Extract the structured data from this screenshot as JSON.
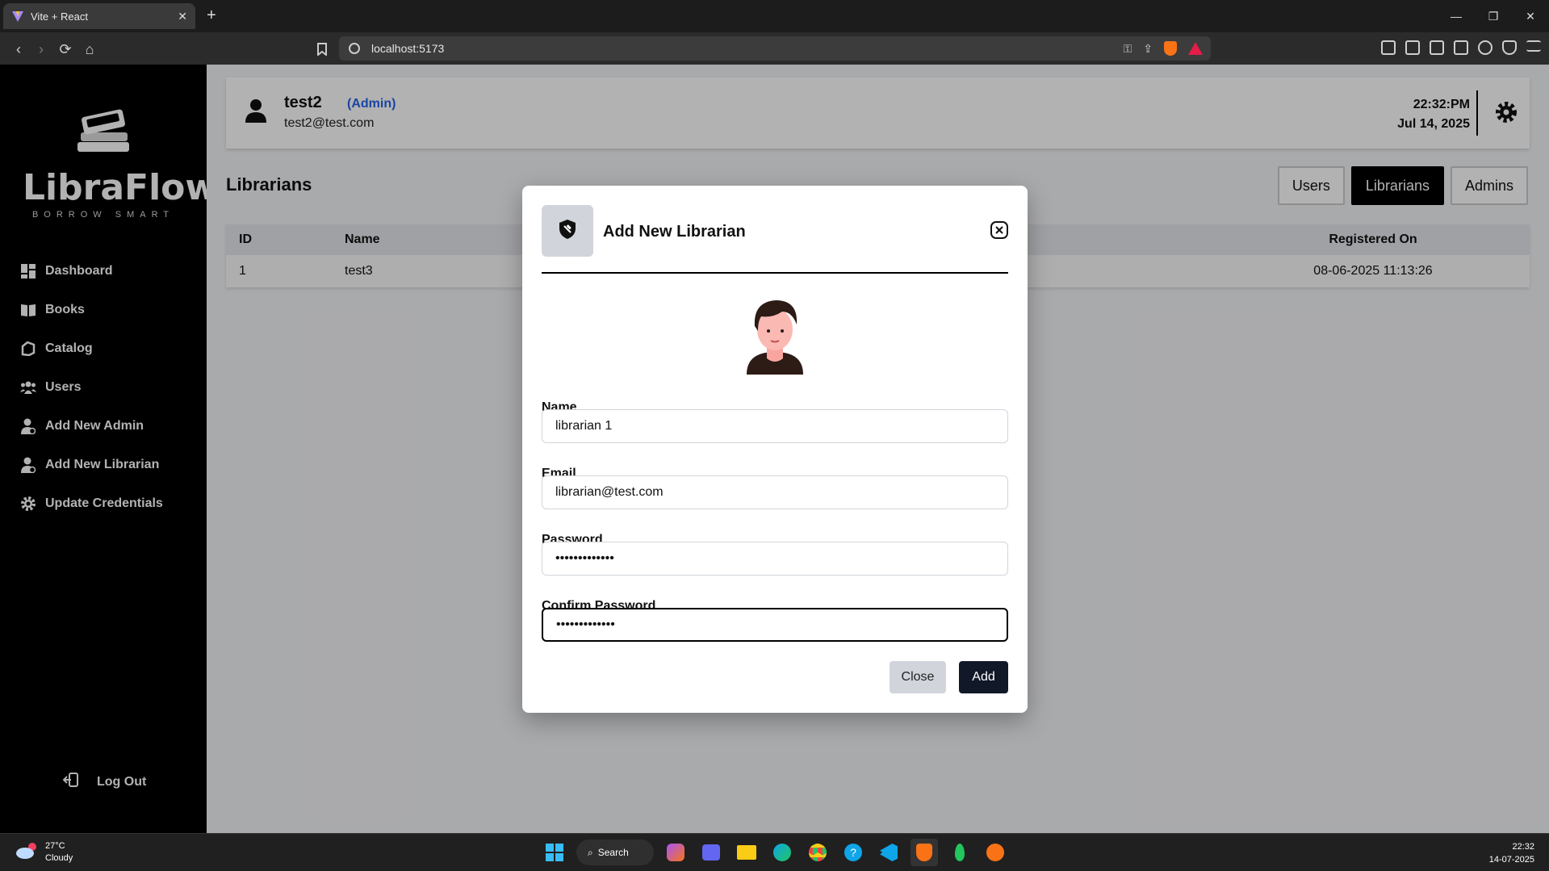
{
  "browser": {
    "tab_title": "Vite + React",
    "url": "localhost:5173"
  },
  "app": {
    "logo_word": "LibraFlow",
    "logo_tagline": "BORROW SMART",
    "nav": [
      {
        "label": "Dashboard",
        "icon": "dashboard-icon"
      },
      {
        "label": "Books",
        "icon": "books-icon"
      },
      {
        "label": "Catalog",
        "icon": "catalog-icon"
      },
      {
        "label": "Users",
        "icon": "users-icon"
      },
      {
        "label": "Add New Admin",
        "icon": "add-admin-icon"
      },
      {
        "label": "Add New Librarian",
        "icon": "add-librarian-icon"
      },
      {
        "label": "Update Credentials",
        "icon": "gear-icon"
      }
    ],
    "logout_label": "Log Out"
  },
  "header": {
    "user_name": "test2",
    "user_role": "(Admin)",
    "user_email": "test2@test.com",
    "time": "22:32:PM",
    "date": "Jul 14, 2025"
  },
  "page": {
    "title": "Librarians",
    "role_tabs": [
      {
        "label": "Users",
        "active": false
      },
      {
        "label": "Librarians",
        "active": true
      },
      {
        "label": "Admins",
        "active": false
      }
    ],
    "table": {
      "columns": [
        "ID",
        "Name",
        "Registered On"
      ],
      "rows": [
        {
          "id": "1",
          "name": "test3",
          "registered": "08-06-2025 11:13:26"
        }
      ]
    }
  },
  "modal": {
    "title": "Add New Librarian",
    "fields": {
      "name_label": "Name",
      "name_value": "librarian 1",
      "email_label": "Email",
      "email_value": "librarian@test.com",
      "password_label": "Password",
      "password_value": "librarian1234",
      "confirm_label": "Confirm Password",
      "confirm_value": "librarian1234"
    },
    "close_label": "Close",
    "add_label": "Add"
  },
  "taskbar": {
    "temperature": "27°C",
    "weather": "Cloudy",
    "search_label": "Search",
    "time": "22:32",
    "date": "14-07-2025"
  },
  "colors": {
    "accent_role": "#2563eb",
    "sidebar_bg": "#000000",
    "primary_button": "#111827"
  }
}
